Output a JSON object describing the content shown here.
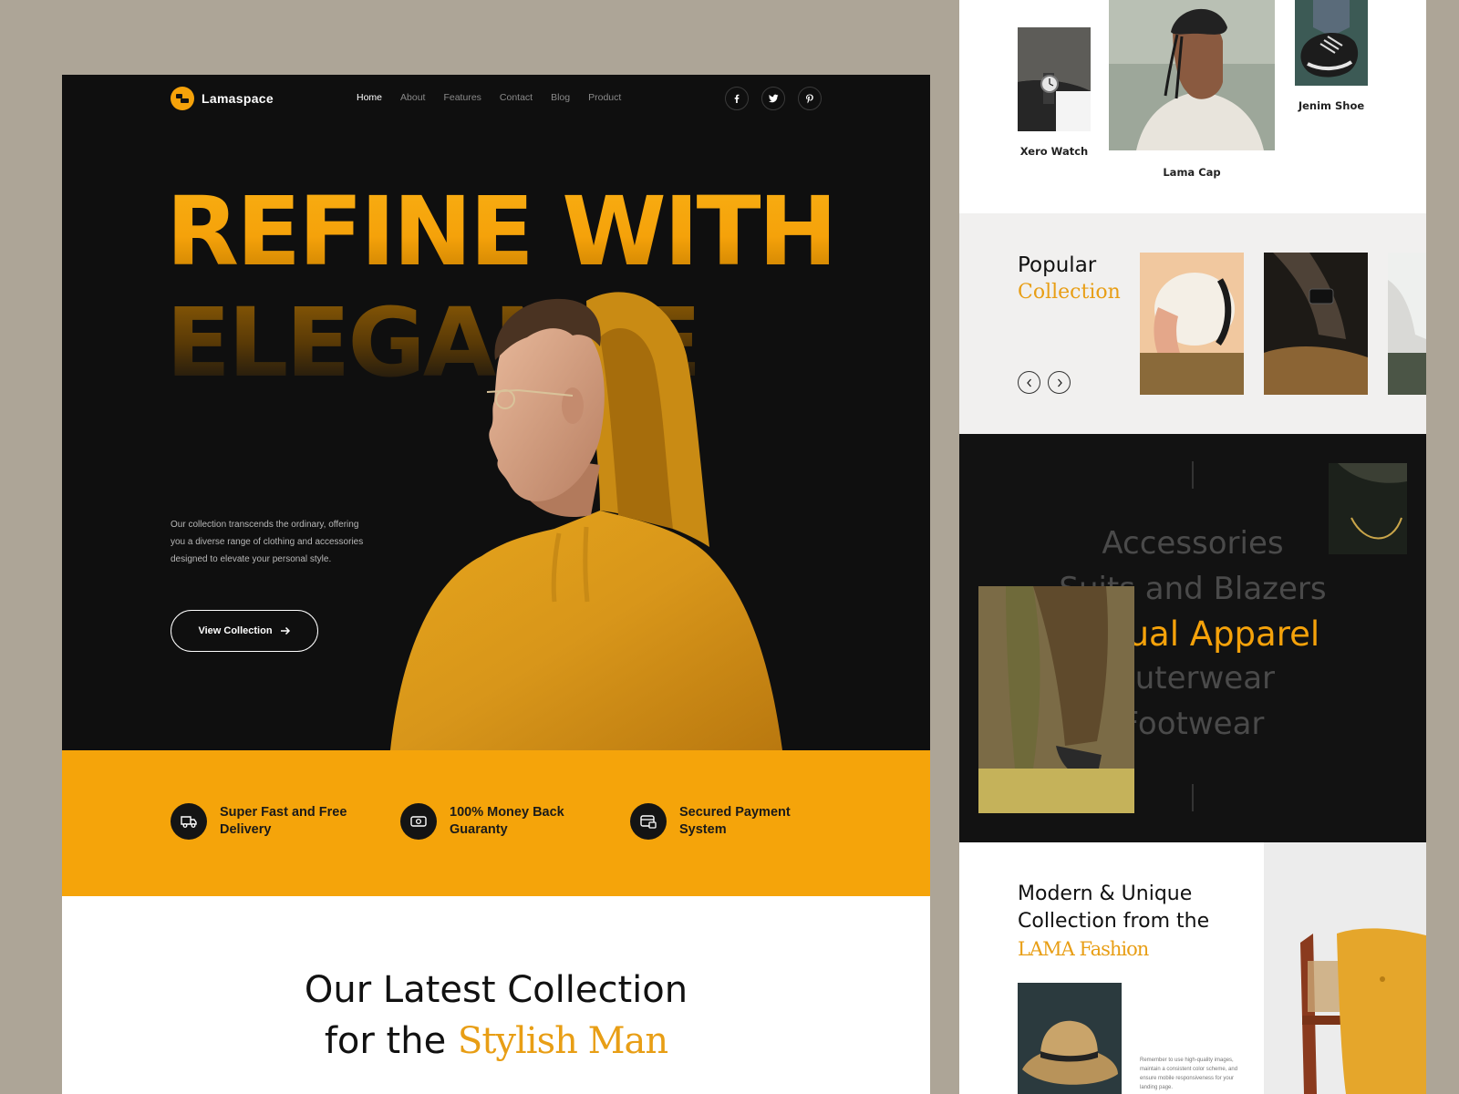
{
  "brand": {
    "name": "Lamaspace"
  },
  "nav": {
    "links": [
      "Home",
      "About",
      "Features",
      "Contact",
      "Blog",
      "Product"
    ],
    "active": "Home"
  },
  "socials": [
    "facebook-icon",
    "twitter-icon",
    "pinterest-icon"
  ],
  "hero": {
    "headline_line1": "REFINE WITH",
    "headline_line2": "ELEGANCE",
    "description": "Our collection transcends the ordinary, offering you a diverse range of clothing and accessories designed to elevate your personal style.",
    "cta_label": "View Collection"
  },
  "features": [
    {
      "icon": "delivery-truck-icon",
      "label": "Super Fast and Free Delivery"
    },
    {
      "icon": "money-icon",
      "label": "100% Money Back Guaranty"
    },
    {
      "icon": "secure-payment-icon",
      "label": "Secured Payment System"
    }
  ],
  "latest": {
    "line1": "Our Latest Collection",
    "line2_prefix": "for the ",
    "line2_accent": "Stylish Man"
  },
  "products": [
    {
      "name": "Xero Watch"
    },
    {
      "name": "Lama Cap"
    },
    {
      "name": "Jenim Shoe"
    }
  ],
  "popular": {
    "title_line1": "Popular",
    "title_line2": "Collection"
  },
  "categories": {
    "items": [
      "Accessories",
      "Suits and Blazers",
      "Casual Apparel",
      "Outerwear",
      "Footwear"
    ],
    "active": "Casual Apparel"
  },
  "modern": {
    "line1": "Modern & Unique",
    "line2": "Collection from the",
    "accent": "LAMA Fashion",
    "note": "Remember to use high-quality images, maintain a consistent color scheme, and ensure mobile responsiveness for your landing page."
  },
  "colors": {
    "accent": "#f5a40a",
    "dark": "#0f0f0f",
    "background": "#ada597"
  }
}
